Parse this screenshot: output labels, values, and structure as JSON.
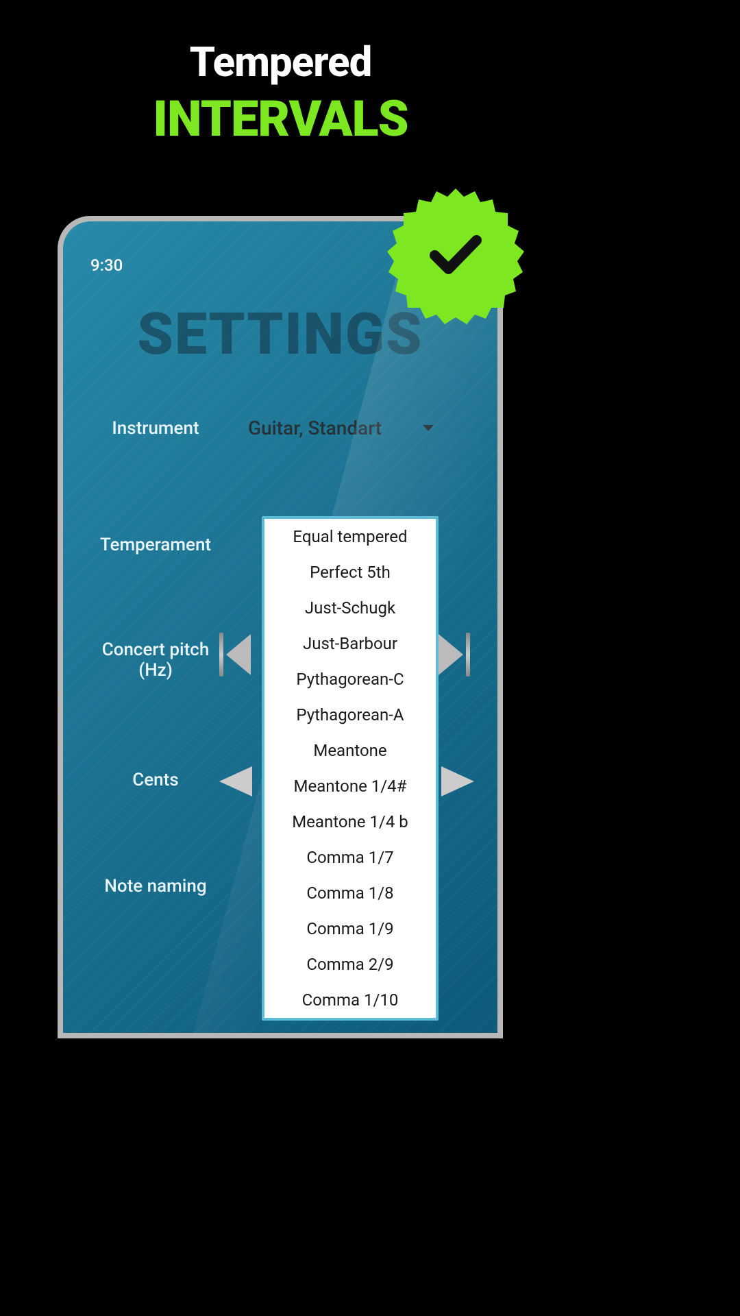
{
  "headline": {
    "line1": "Tempered",
    "line2": "INTERVALS"
  },
  "phone": {
    "status_time": "9:30",
    "page_title": "SETTINGS",
    "rows": {
      "instrument": {
        "label": "Instrument",
        "value": "Guitar, Standart"
      },
      "temperament": {
        "label": "Temperament"
      },
      "pitch": {
        "label": "Concert pitch (Hz)"
      },
      "cents": {
        "label": "Cents"
      },
      "naming": {
        "label": "Note naming"
      }
    },
    "temperament_options": [
      "Equal tempered",
      "Perfect 5th",
      "Just-Schugk",
      "Just-Barbour",
      "Pythagorean-C",
      "Pythagorean-A",
      "Meantone",
      "Meantone 1/4#",
      "Meantone 1/4 b",
      "Comma 1/7",
      "Comma 1/8",
      "Comma 1/9",
      "Comma 2/9",
      "Comma 1/10"
    ]
  }
}
